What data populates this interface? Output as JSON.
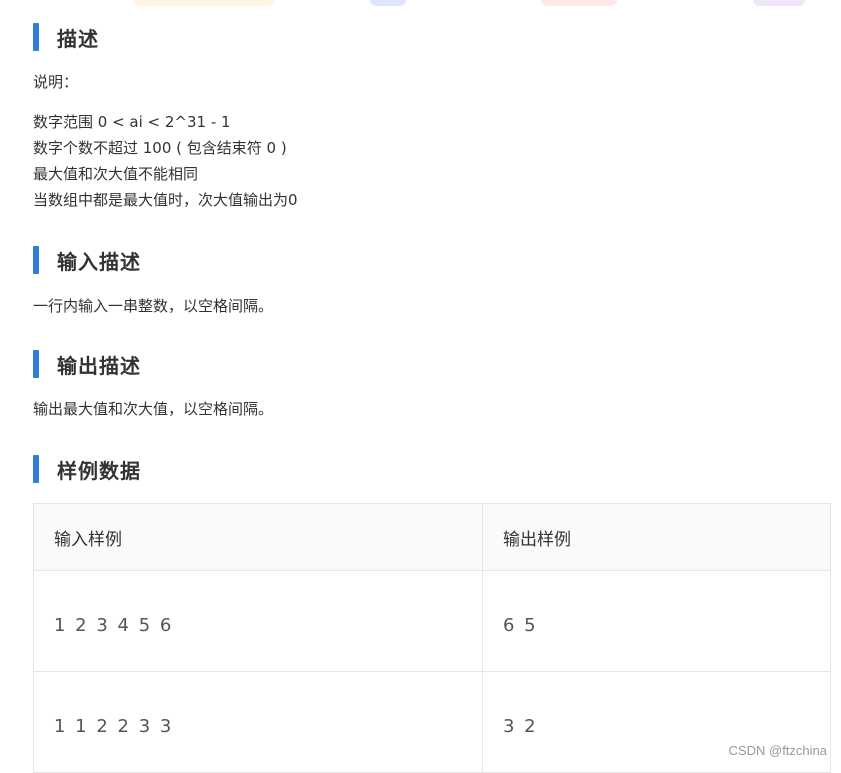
{
  "sections": {
    "description": {
      "title": "描述",
      "label": "说明：",
      "lines": [
        "数字范围 0 < ai < 2^31 - 1",
        "数字个数不超过 100 ( 包含结束符 0 )",
        "最大值和次大值不能相同",
        "当数组中都是最大值时，次大值输出为0"
      ]
    },
    "input": {
      "title": "输入描述",
      "body": "一行内输入一串整数，以空格间隔。"
    },
    "output": {
      "title": "输出描述",
      "body": "输出最大值和次大值，以空格间隔。"
    },
    "samples": {
      "title": "样例数据",
      "headers": [
        "输入样例",
        "输出样例"
      ],
      "rows": [
        [
          "1 2 3 4 5 6",
          "6 5"
        ],
        [
          "1 1 2 2 3 3",
          "3 2"
        ]
      ]
    }
  },
  "watermark": "CSDN @ftzchina",
  "colors": {
    "accent_bar": "#2f7fd6",
    "table_header_bg": "#fafafa",
    "table_border": "#e6e6e6"
  }
}
